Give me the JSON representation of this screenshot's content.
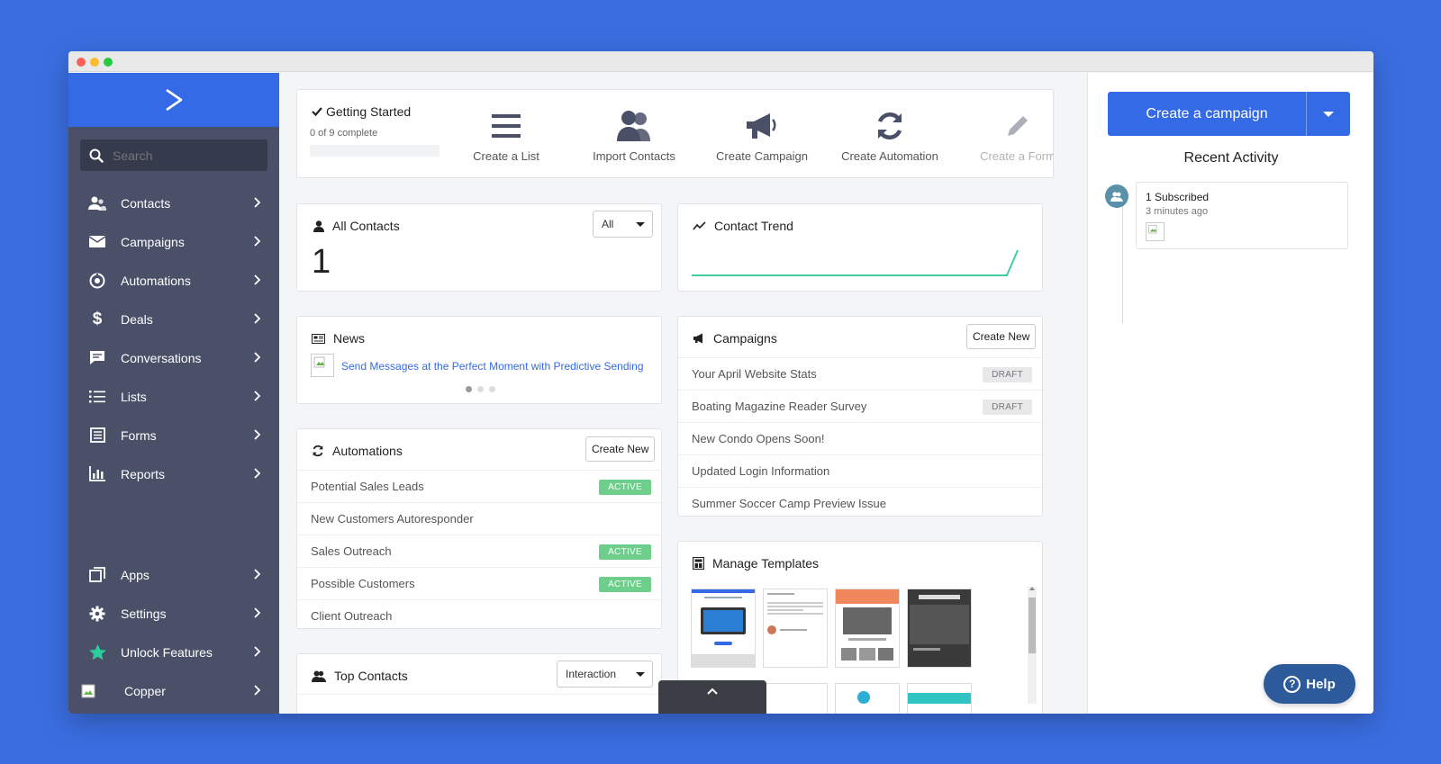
{
  "sidebar": {
    "search_placeholder": "Search",
    "items": [
      {
        "label": "Contacts",
        "icon": "contacts-icon"
      },
      {
        "label": "Campaigns",
        "icon": "envelope-icon"
      },
      {
        "label": "Automations",
        "icon": "automation-icon"
      },
      {
        "label": "Deals",
        "icon": "dollar-icon"
      },
      {
        "label": "Conversations",
        "icon": "chat-icon"
      },
      {
        "label": "Lists",
        "icon": "list-icon"
      },
      {
        "label": "Forms",
        "icon": "form-icon"
      },
      {
        "label": "Reports",
        "icon": "bar-chart-icon"
      }
    ],
    "bottom_items": [
      {
        "label": "Apps",
        "icon": "apps-icon"
      },
      {
        "label": "Settings",
        "icon": "gear-icon"
      },
      {
        "label": "Unlock Features",
        "icon": "star-icon",
        "icon_color": "#2ecc9a"
      },
      {
        "label": "Copper",
        "icon": "broken-image-icon"
      }
    ]
  },
  "getting_started": {
    "title": "Getting Started",
    "progress_text": "0 of 9 complete",
    "progress": 0,
    "actions": [
      {
        "label": "Create a List",
        "icon": "list-icon"
      },
      {
        "label": "Import Contacts",
        "icon": "users-icon"
      },
      {
        "label": "Create Campaign",
        "icon": "megaphone-icon"
      },
      {
        "label": "Create Automation",
        "icon": "refresh-icon"
      },
      {
        "label": "Create a Form",
        "icon": "pencil-icon"
      }
    ]
  },
  "all_contacts": {
    "title": "All Contacts",
    "filter": "All",
    "count": "1"
  },
  "contact_trend": {
    "title": "Contact Trend",
    "line_color": "#3ecfa0"
  },
  "news": {
    "title": "News",
    "link": "Send Messages at the Perfect Moment with Predictive Sending",
    "link_color": "#356ae6",
    "pages": 3,
    "current_page": 1
  },
  "campaigns": {
    "title": "Campaigns",
    "create_label": "Create New",
    "rows": [
      {
        "name": "Your April Website Stats",
        "status": "DRAFT"
      },
      {
        "name": "Boating Magazine Reader Survey",
        "status": "DRAFT"
      },
      {
        "name": "New Condo Opens Soon!",
        "status": ""
      },
      {
        "name": "Updated Login Information",
        "status": ""
      },
      {
        "name": "Summer Soccer Camp Preview Issue",
        "status": ""
      }
    ]
  },
  "automations": {
    "title": "Automations",
    "create_label": "Create New",
    "rows": [
      {
        "name": "Potential Sales Leads",
        "status": "ACTIVE"
      },
      {
        "name": "New Customers Autoresponder",
        "status": ""
      },
      {
        "name": "Sales Outreach",
        "status": "ACTIVE"
      },
      {
        "name": "Possible Customers",
        "status": "ACTIVE"
      },
      {
        "name": "Client Outreach",
        "status": ""
      }
    ]
  },
  "top_contacts": {
    "title": "Top Contacts",
    "filter": "Interaction"
  },
  "manage_templates": {
    "title": "Manage Templates"
  },
  "right_panel": {
    "create_campaign": "Create a campaign",
    "recent_activity_title": "Recent Activity",
    "activity": [
      {
        "title": "1 Subscribed",
        "time": "3 minutes ago"
      }
    ]
  },
  "help": {
    "label": "Help"
  },
  "colors": {
    "brand": "#356ae6",
    "sidebar": "#4a5068",
    "active_badge": "#6ecf8c",
    "help_button": "#2d5a9b"
  }
}
